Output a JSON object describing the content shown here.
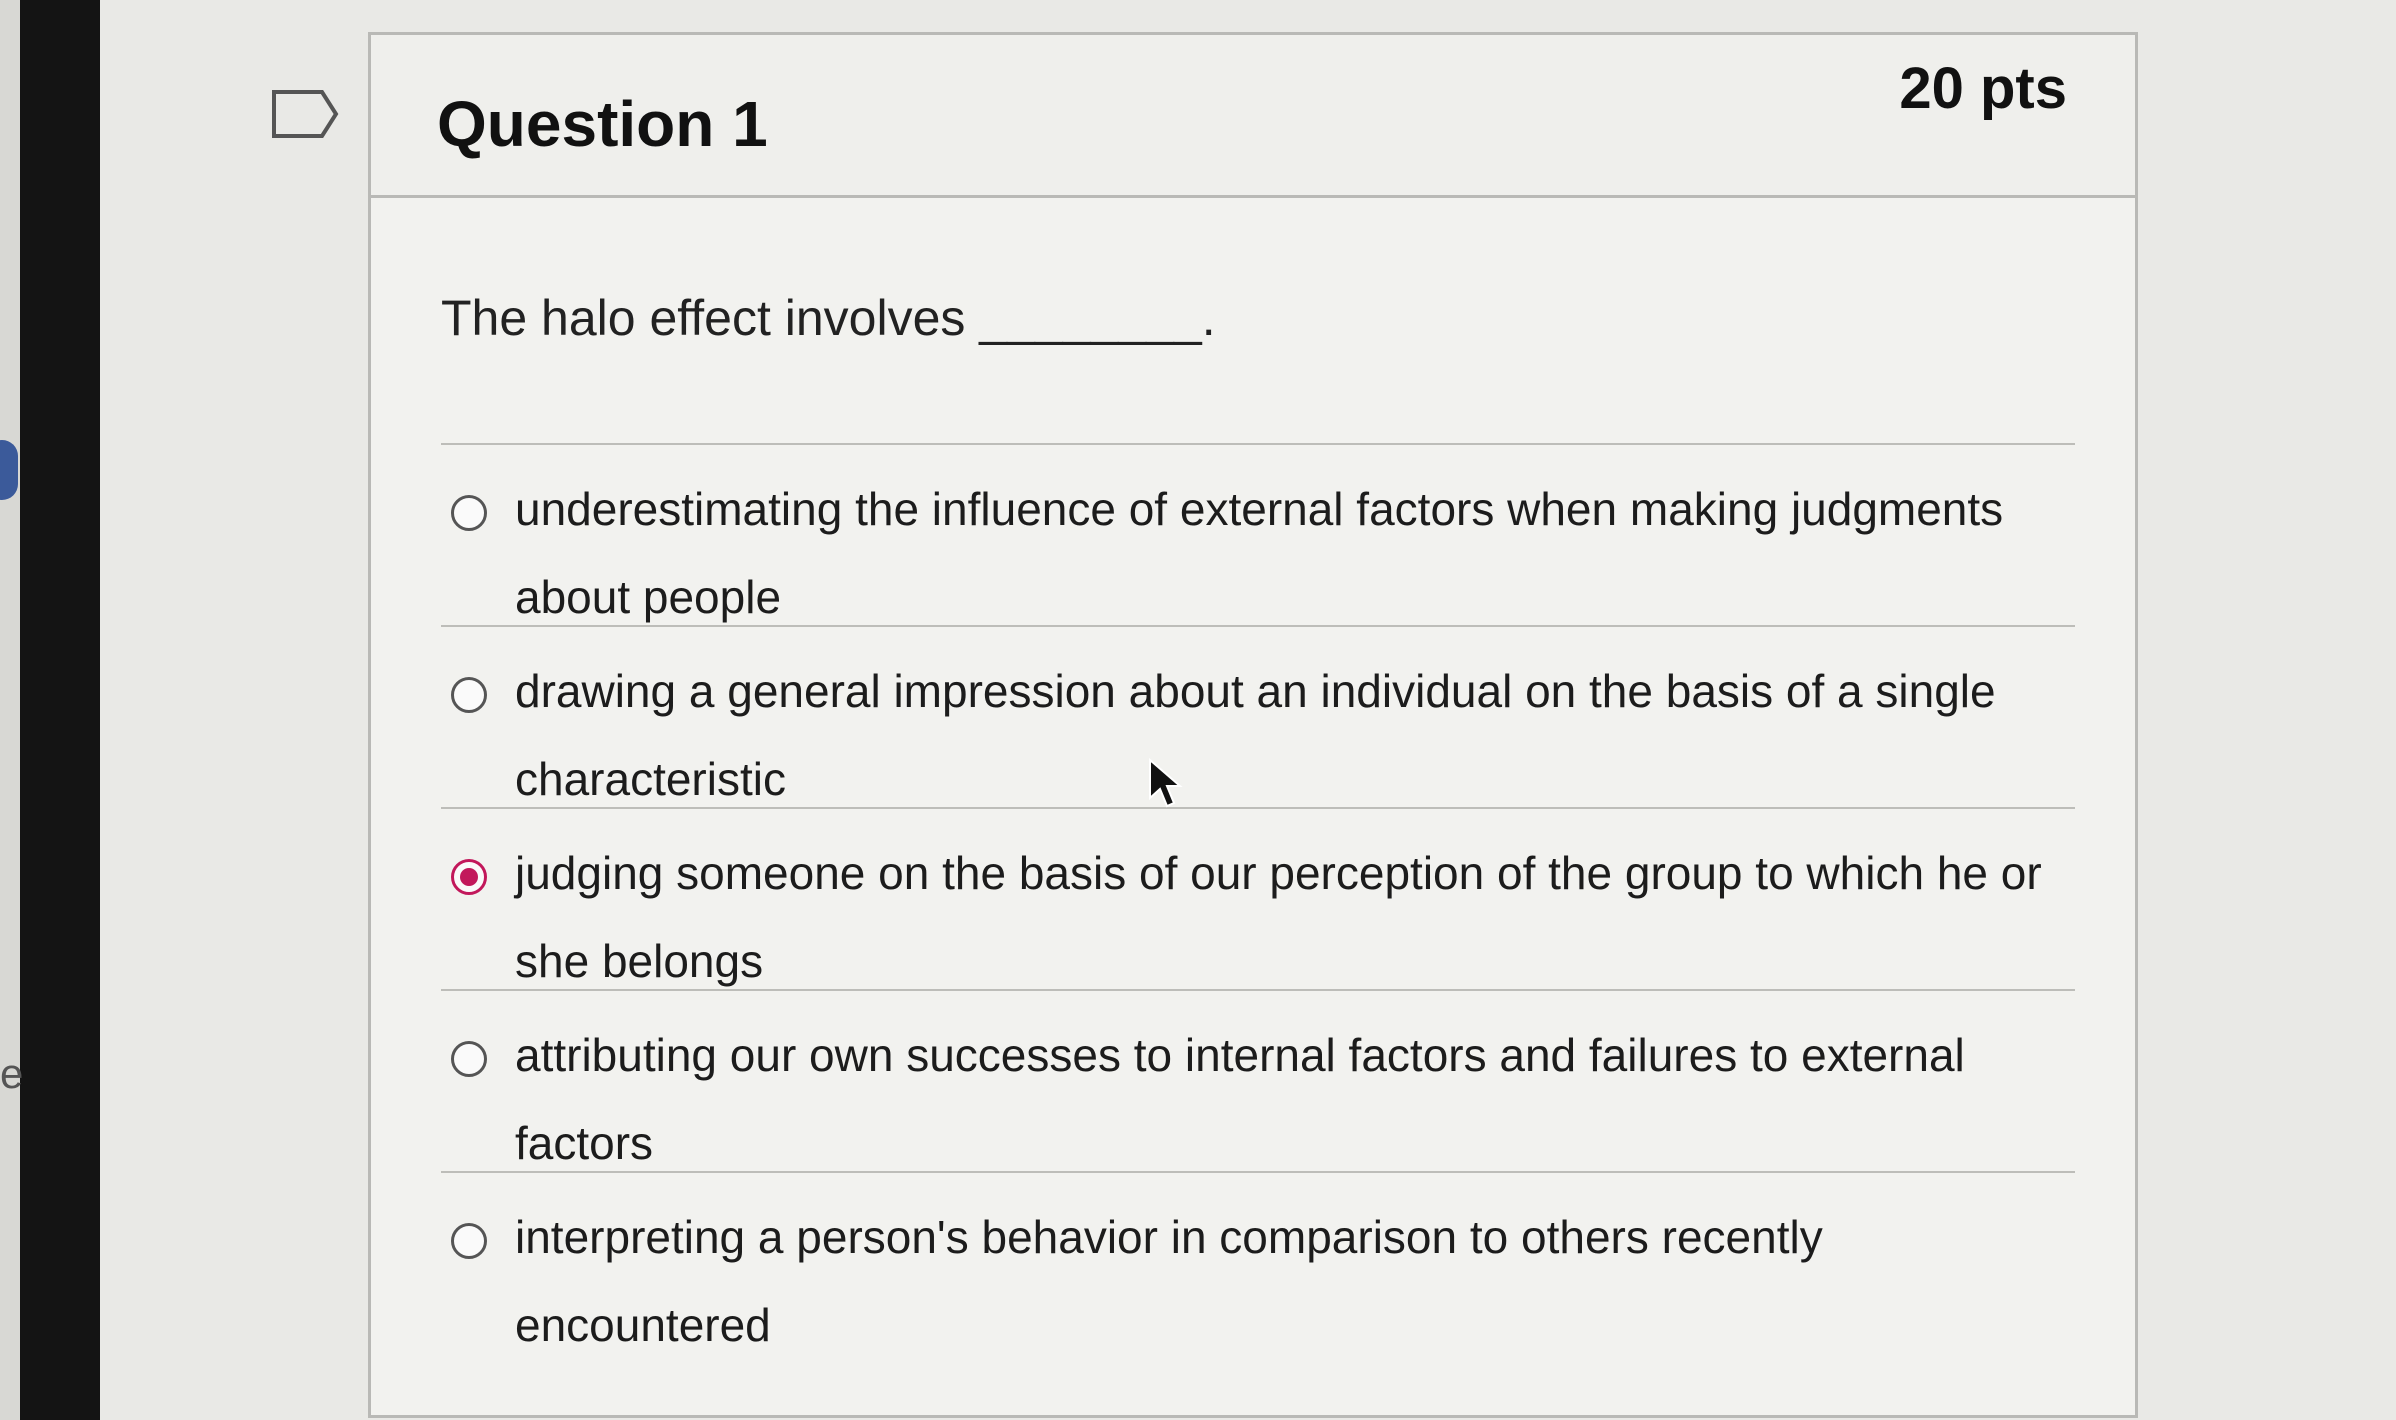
{
  "question": {
    "title": "Question 1",
    "points": "20 pts",
    "prompt": "The halo effect involves ________.",
    "options": [
      {
        "label": "underestimating the influence of external factors when making judgments about people",
        "selected": false
      },
      {
        "label": "drawing a general impression about an individual on the basis of a single characteristic",
        "selected": false
      },
      {
        "label": "judging someone on the basis of our perception of the group to which he or she belongs",
        "selected": true
      },
      {
        "label": "attributing our own successes to internal factors and failures to external factors",
        "selected": false
      },
      {
        "label": "interpreting a person's behavior in comparison to others recently encountered",
        "selected": false
      }
    ]
  },
  "side": {
    "letter": "e"
  },
  "icons": {
    "flag": "flag-icon",
    "radio": "radio-button-icon",
    "cursor": "mouse-cursor-icon"
  },
  "colors": {
    "accent": "#c2185b",
    "background": "#e9e9e6",
    "card": "#f2f2ef"
  }
}
